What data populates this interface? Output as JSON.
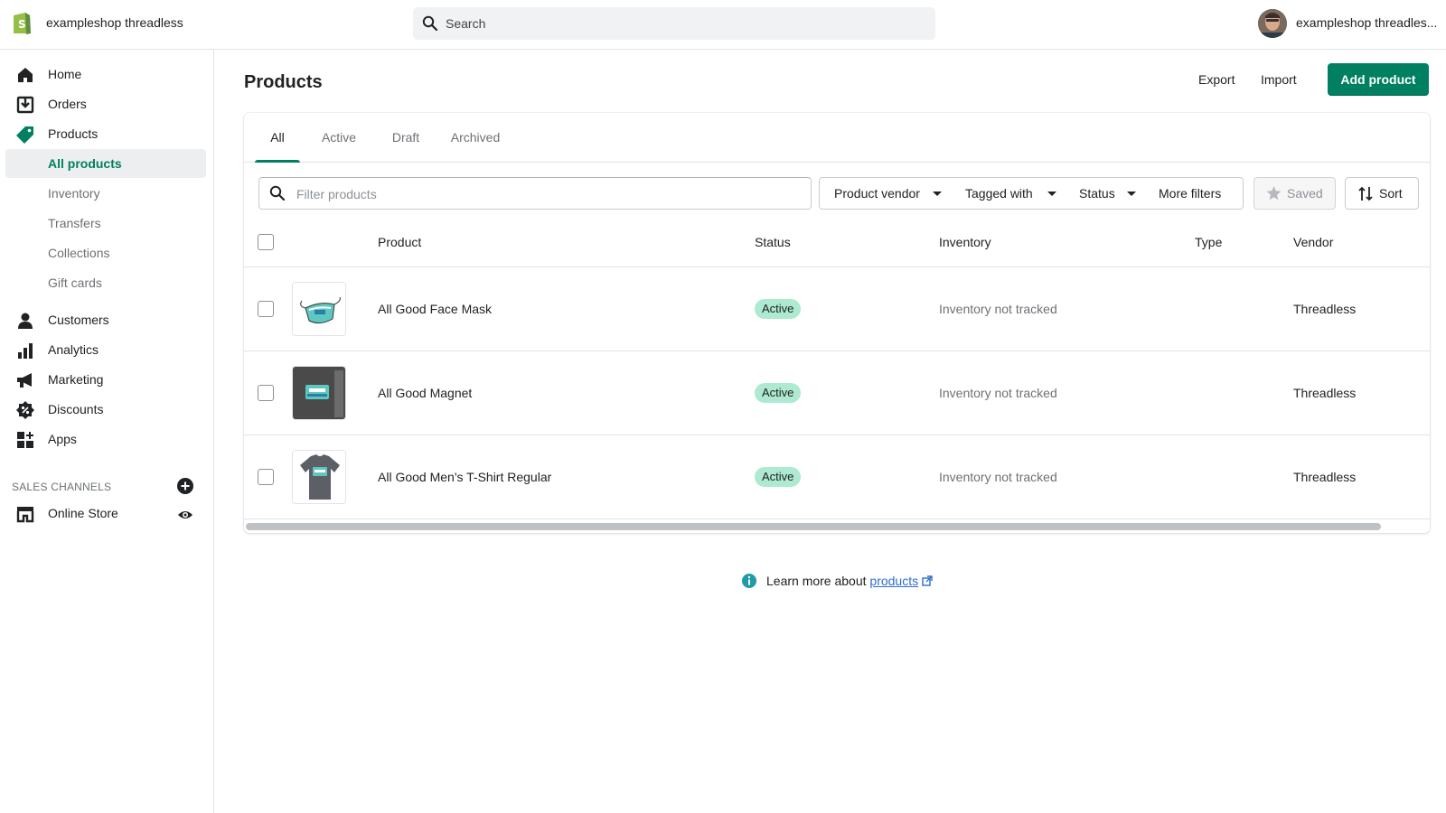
{
  "topbar": {
    "shop_name": "exampleshop threadless",
    "search_placeholder": "Search",
    "user_name": "exampleshop threadles..."
  },
  "sidebar": {
    "items": [
      {
        "label": "Home",
        "icon": "home-icon"
      },
      {
        "label": "Orders",
        "icon": "orders-icon"
      },
      {
        "label": "Products",
        "icon": "tag-icon"
      },
      {
        "label": "All products"
      },
      {
        "label": "Inventory"
      },
      {
        "label": "Transfers"
      },
      {
        "label": "Collections"
      },
      {
        "label": "Gift cards"
      },
      {
        "label": "Customers",
        "icon": "person-icon"
      },
      {
        "label": "Analytics",
        "icon": "bar-chart-icon"
      },
      {
        "label": "Marketing",
        "icon": "megaphone-icon"
      },
      {
        "label": "Discounts",
        "icon": "discount-icon"
      },
      {
        "label": "Apps",
        "icon": "apps-icon"
      }
    ],
    "sales_channels_label": "SALES CHANNELS",
    "online_store_label": "Online Store"
  },
  "page": {
    "title": "Products",
    "export_label": "Export",
    "import_label": "Import",
    "add_product_label": "Add product"
  },
  "tabs": [
    "All",
    "Active",
    "Draft",
    "Archived"
  ],
  "filters": {
    "placeholder": "Filter products",
    "vendor_label": "Product vendor",
    "tagged_label": "Tagged with",
    "status_label": "Status",
    "more_label": "More filters",
    "saved_label": "Saved",
    "sort_label": "Sort"
  },
  "table": {
    "headers": {
      "product": "Product",
      "status": "Status",
      "inventory": "Inventory",
      "type": "Type",
      "vendor": "Vendor"
    },
    "rows": [
      {
        "name": "All Good Face Mask",
        "status": "Active",
        "inventory": "Inventory not tracked",
        "type": "",
        "vendor": "Threadless"
      },
      {
        "name": "All Good Magnet",
        "status": "Active",
        "inventory": "Inventory not tracked",
        "type": "",
        "vendor": "Threadless"
      },
      {
        "name": "All Good Men's T-Shirt Regular",
        "status": "Active",
        "inventory": "Inventory not tracked",
        "type": "",
        "vendor": "Threadless"
      }
    ]
  },
  "footer": {
    "learn_prefix": "Learn more about ",
    "learn_link": "products"
  },
  "colors": {
    "brand_green": "#008060",
    "badge_green": "#aee9d1",
    "link_blue": "#2c6ecb",
    "info_teal": "#1f9ca7"
  }
}
